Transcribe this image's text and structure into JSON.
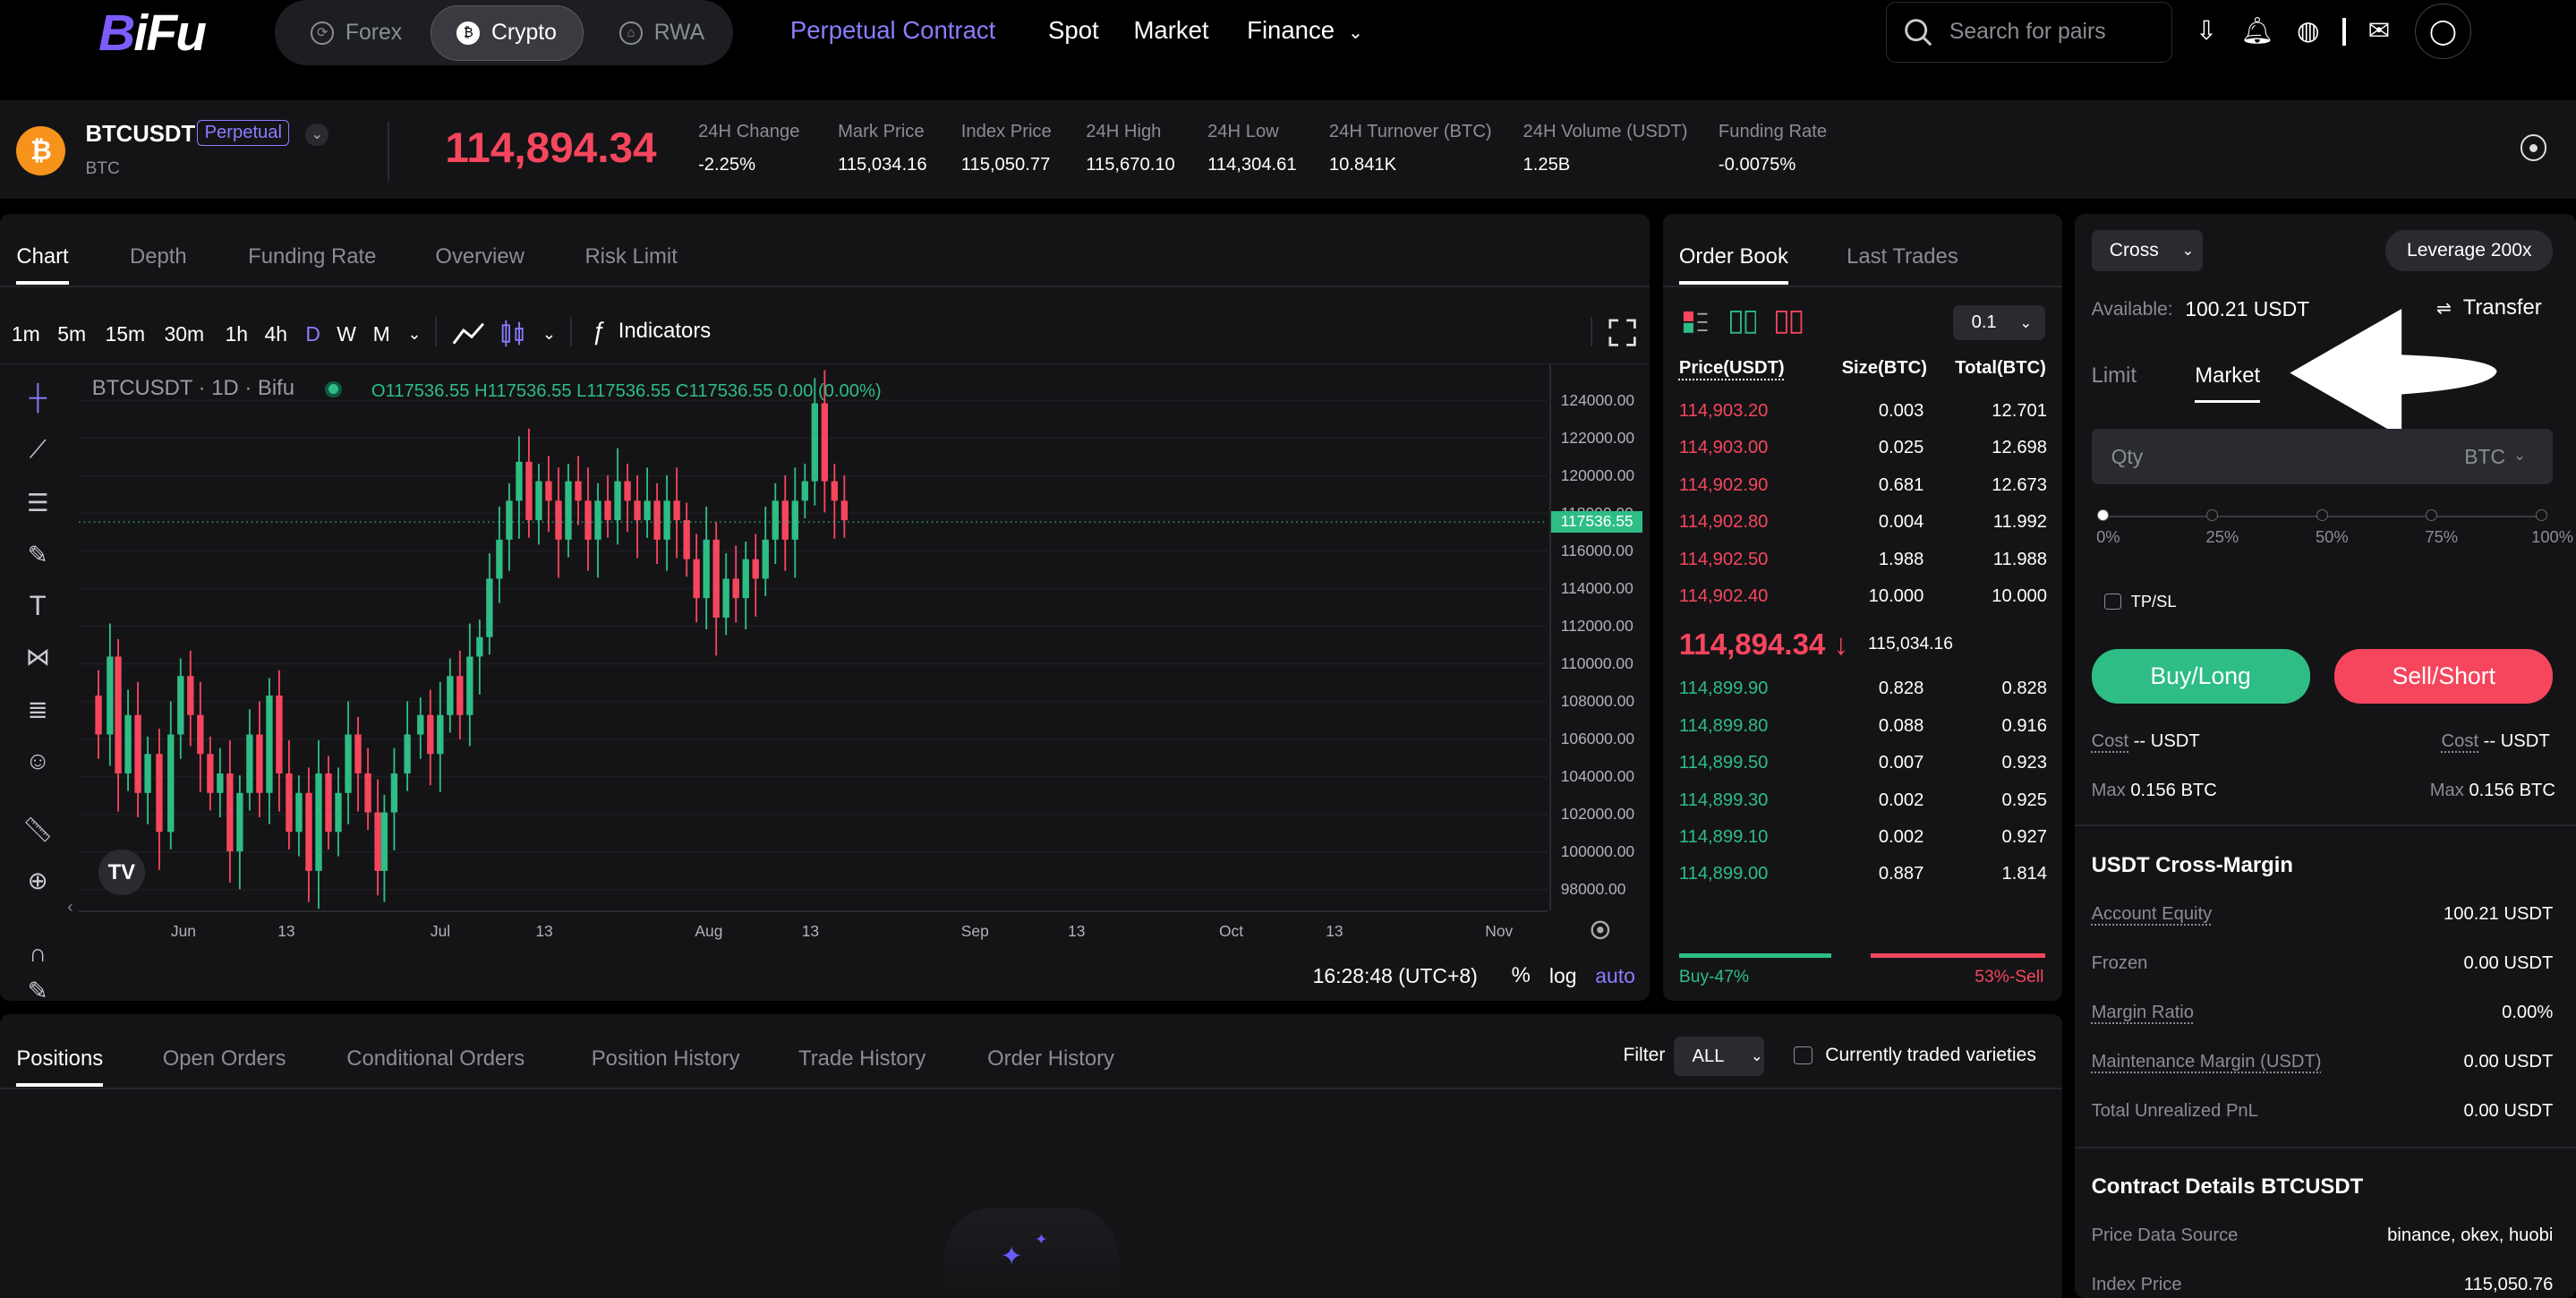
{
  "nav": {
    "logo": "BiFu",
    "segments": [
      "Forex",
      "Crypto",
      "RWA"
    ],
    "links": [
      "Perpetual Contract",
      "Spot",
      "Market",
      "Finance"
    ],
    "search_placeholder": "Search for pairs"
  },
  "ticker": {
    "symbol": "BTCUSDT",
    "badge": "Perpetual",
    "base": "BTC",
    "last_price": "114,894.34",
    "stats": [
      {
        "label": "24H Change",
        "value": "-2.25%"
      },
      {
        "label": "Mark Price",
        "value": "115,034.16"
      },
      {
        "label": "Index Price",
        "value": "115,050.77"
      },
      {
        "label": "24H High",
        "value": "115,670.10"
      },
      {
        "label": "24H Low",
        "value": "114,304.61"
      },
      {
        "label": "24H Turnover (BTC)",
        "value": "10.841K"
      },
      {
        "label": "24H Volume (USDT)",
        "value": "1.25B"
      },
      {
        "label": "Funding Rate",
        "value": "-0.0075%"
      }
    ]
  },
  "chart_panel": {
    "tabs": [
      "Chart",
      "Depth",
      "Funding Rate",
      "Overview",
      "Risk Limit"
    ],
    "timeframes": [
      "1m",
      "5m",
      "15m",
      "30m",
      "1h",
      "4h",
      "D",
      "W",
      "M"
    ],
    "indicators_label": "Indicators",
    "legend_title": "BTCUSDT · 1D · Bifu",
    "ohlc": "O117536.55 H117536.55 L117536.55 C117536.55 0.00 (0.00%)",
    "price_axis": [
      "124000.00",
      "122000.00",
      "120000.00",
      "118000.00",
      "116000.00",
      "114000.00",
      "112000.00",
      "110000.00",
      "108000.00",
      "106000.00",
      "104000.00",
      "102000.00",
      "100000.00",
      "98000.00"
    ],
    "last_label": "117536.55",
    "time_axis": [
      "Jun",
      "13",
      "Jul",
      "13",
      "Aug",
      "13",
      "Sep",
      "13",
      "Oct",
      "13",
      "Nov"
    ],
    "clock": "16:28:48 (UTC+8)",
    "scale_opts": [
      "%",
      "log",
      "auto"
    ]
  },
  "chart_data": {
    "type": "candlestick",
    "ylim": [
      97000,
      125000
    ],
    "candles": []
  },
  "orderbook": {
    "tabs": [
      "Order Book",
      "Last Trades"
    ],
    "precision": "0.1",
    "headers": [
      "Price(USDT)",
      "Size(BTC)",
      "Total(BTC)"
    ],
    "asks": [
      [
        "114,903.20",
        "0.003",
        "12.701"
      ],
      [
        "114,903.00",
        "0.025",
        "12.698"
      ],
      [
        "114,902.90",
        "0.681",
        "12.673"
      ],
      [
        "114,902.80",
        "0.004",
        "11.992"
      ],
      [
        "114,902.50",
        "1.988",
        "11.988"
      ],
      [
        "114,902.40",
        "10.000",
        "10.000"
      ]
    ],
    "mid_price": "114,894.34 ↓",
    "mid_mark": "115,034.16",
    "bids": [
      [
        "114,899.90",
        "0.828",
        "0.828"
      ],
      [
        "114,899.80",
        "0.088",
        "0.916"
      ],
      [
        "114,899.50",
        "0.007",
        "0.923"
      ],
      [
        "114,899.30",
        "0.002",
        "0.925"
      ],
      [
        "114,899.10",
        "0.002",
        "0.927"
      ],
      [
        "114,899.00",
        "0.887",
        "1.814"
      ]
    ],
    "buy_ratio": "Buy-47%",
    "sell_ratio": "53%-Sell",
    "buy_fraction": 0.47
  },
  "bottom": {
    "tabs": [
      "Positions",
      "Open Orders",
      "Conditional Orders",
      "Position History",
      "Trade History",
      "Order History"
    ],
    "filter_label": "Filter",
    "filter_value": "ALL",
    "checkbox_label": "Currently traded varieties"
  },
  "trade": {
    "margin_mode": "Cross",
    "leverage": "Leverage 200x",
    "available_label": "Available:",
    "available_value": "100.21 USDT",
    "transfer": "Transfer",
    "order_tabs": [
      "Limit",
      "Market"
    ],
    "qty_placeholder": "Qty",
    "qty_unit": "BTC",
    "slider_marks": [
      "0%",
      "25%",
      "50%",
      "75%",
      "100%"
    ],
    "tpsl": "TP/SL",
    "buy": "Buy/Long",
    "sell": "Sell/Short",
    "cost_label": "Cost",
    "cost_value": "-- USDT",
    "max_label": "Max",
    "max_value": "0.156 BTC"
  },
  "margin": {
    "title": "USDT Cross-Margin",
    "rows": [
      [
        "Account Equity",
        "100.21 USDT"
      ],
      [
        "Frozen",
        "0.00 USDT"
      ],
      [
        "Margin Ratio",
        "0.00%"
      ],
      [
        "Maintenance Margin (USDT)",
        "0.00 USDT"
      ],
      [
        "Total Unrealized PnL",
        "0.00 USDT"
      ]
    ]
  },
  "contract": {
    "title": "Contract Details BTCUSDT",
    "rows": [
      [
        "Price Data Source",
        "binance, okex, huobi"
      ],
      [
        "Index Price",
        "115,050.76"
      ]
    ]
  },
  "colors": {
    "accent": "#8b7dff",
    "up": "#2ebd85",
    "down": "#f6465d",
    "panel": "#141416"
  }
}
